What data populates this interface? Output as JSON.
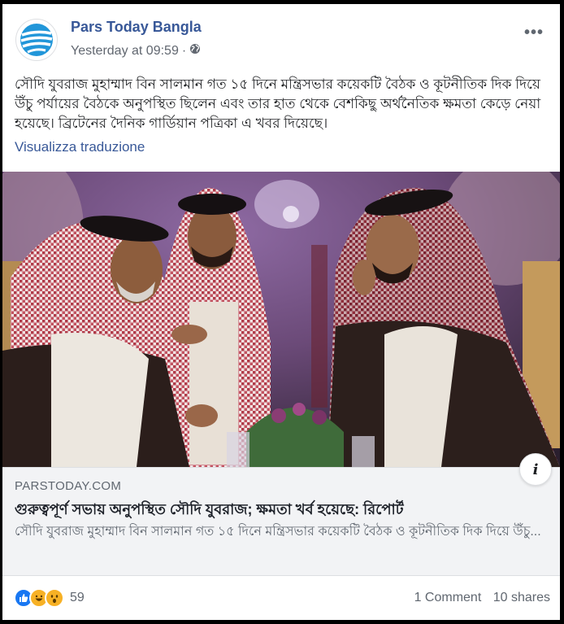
{
  "post": {
    "page_name": "Pars Today Bangla",
    "timestamp": "Yesterday at 09:59",
    "separator": "·",
    "privacy_icon": "globe-icon",
    "more_icon": "more-horizontal-icon",
    "text": "সৌদি যুবরাজ মুহাম্মাদ বিন সালমান গত ১৫ দিনে মন্ত্রিসভার কয়েকটি বৈঠক ও কূটনীতিক দিক দিয়ে উঁচু পর্যায়ের বৈঠকে অনুপস্থিত ছিলেন এবং তার হাত থেকে বেশকিছু অর্থনৈতিক ক্ষমতা কেড়ে নেয়া হয়েছে। ব্রিটেনের দৈনিক গার্ডিয়ান পত্রিকা এ খবর দিয়েছে।",
    "translate_label": "Visualizza traduzione"
  },
  "link": {
    "domain": "PARSTODAY.COM",
    "title": "গুরুত্বপূর্ণ সভায় অনুপস্থিত সৌদি যুবরাজ; ক্ষমতা খর্ব হয়েছে: রিপোর্ট",
    "description": "সৌদি যুবরাজ মুহাম্মাদ বিন সালমান গত ১৫ দিনে মন্ত্রিসভার কয়েকটি বৈঠক ও কূটনীতিক দিক দিয়ে উঁচু...",
    "info_icon": "info-icon",
    "info_glyph": "i"
  },
  "footer": {
    "reactions": [
      "like-icon",
      "haha-icon",
      "wow-icon"
    ],
    "reaction_count": "59",
    "comments": "1 Comment",
    "shares": "10 shares"
  },
  "colors": {
    "page_name": "#385898",
    "link_blue": "#385898",
    "secondary_text": "#606770",
    "link_box_bg": "#f2f3f5"
  }
}
